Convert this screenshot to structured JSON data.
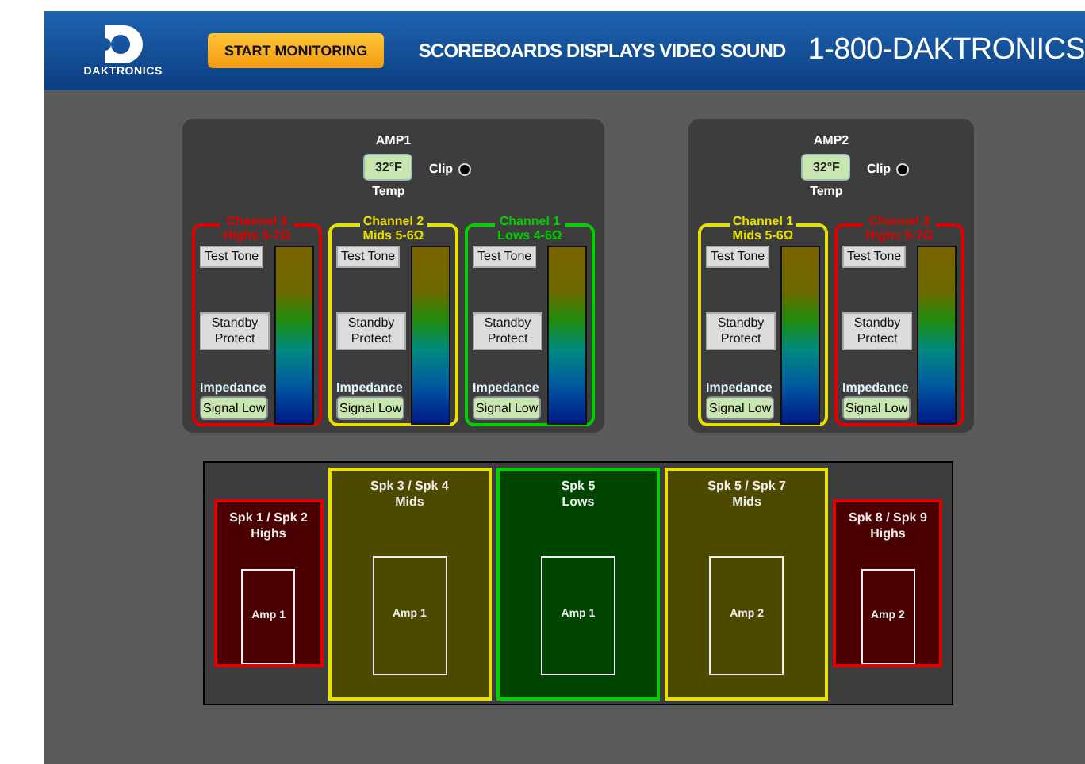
{
  "header": {
    "logo_text": "DAKTRONICS",
    "button": "START MONITORING",
    "tagline": "SCOREBOARDS DISPLAYS VIDEO SOUND",
    "phone": "1-800-DAKTRONICS"
  },
  "amps": [
    {
      "title": "AMP1",
      "temp": "32°F",
      "temp_label": "Temp",
      "clip_label": "Clip",
      "channels": [
        {
          "name": "Channel 3",
          "band": "Highs 5-7Ω",
          "color": "#e00000",
          "test_tone": "Test Tone",
          "standby": "Standby Protect",
          "impedance": "Impedance",
          "signal": "Signal Low"
        },
        {
          "name": "Channel 2",
          "band": "Mids 5-6Ω",
          "color": "#e8e000",
          "test_tone": "Test Tone",
          "standby": "Standby Protect",
          "impedance": "Impedance",
          "signal": "Signal Low"
        },
        {
          "name": "Channel 1",
          "band": "Lows 4-6Ω",
          "color": "#00d000",
          "test_tone": "Test Tone",
          "standby": "Standby Protect",
          "impedance": "Impedance",
          "signal": "Signal Low"
        }
      ]
    },
    {
      "title": "AMP2",
      "temp": "32°F",
      "temp_label": "Temp",
      "clip_label": "Clip",
      "channels": [
        {
          "name": "Channel 1",
          "band": "Mids 5-6Ω",
          "color": "#e8e000",
          "test_tone": "Test Tone",
          "standby": "Standby Protect",
          "impedance": "Impedance",
          "signal": "Signal Low"
        },
        {
          "name": "Channel 3",
          "band": "Highs 5-7Ω",
          "color": "#e00000",
          "test_tone": "Test Tone",
          "standby": "Standby Protect",
          "impedance": "Impedance",
          "signal": "Signal Low"
        }
      ]
    }
  ],
  "speakers": [
    {
      "name": "Spk 1 / Spk 2",
      "band": "Highs",
      "amp": "Amp 1",
      "color": "#e00000",
      "kind": "short"
    },
    {
      "name": "Spk 3 / Spk 4",
      "band": "Mids",
      "amp": "Amp 1",
      "color": "#e8e000",
      "kind": "tall"
    },
    {
      "name": "Spk 5",
      "band": "Lows",
      "amp": "Amp 1",
      "color": "#00d000",
      "kind": "tall"
    },
    {
      "name": "Spk 5 / Spk 7",
      "band": "Mids",
      "amp": "Amp 2",
      "color": "#e8e000",
      "kind": "tall"
    },
    {
      "name": "Spk 8 / Spk 9",
      "band": "Highs",
      "amp": "Amp 2",
      "color": "#e00000",
      "kind": "short"
    }
  ]
}
